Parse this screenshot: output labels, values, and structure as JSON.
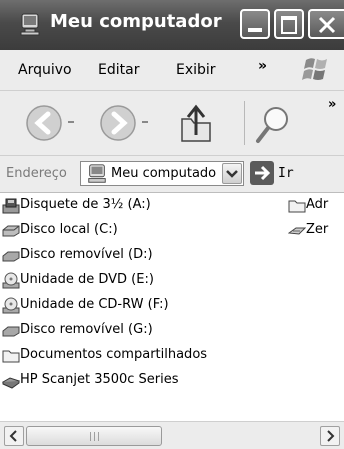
{
  "window": {
    "title": "Meu computador"
  },
  "menu": {
    "items": [
      "Arquivo",
      "Editar",
      "Exibir"
    ],
    "overflow": "»"
  },
  "toolbar": {
    "overflow": "»"
  },
  "address": {
    "label": "Endereço",
    "value": "Meu computador",
    "go_label": "Ir"
  },
  "items_left": [
    {
      "label": "Disquete de 3½ (A:)",
      "icon": "floppy-drive-icon"
    },
    {
      "label": "Disco local (C:)",
      "icon": "hard-disk-icon"
    },
    {
      "label": "Disco removível (D:)",
      "icon": "removable-disk-icon"
    },
    {
      "label": "Unidade de DVD (E:)",
      "icon": "dvd-drive-icon"
    },
    {
      "label": "Unidade de CD-RW (F:)",
      "icon": "cd-drive-icon"
    },
    {
      "label": "Disco removível (G:)",
      "icon": "removable-disk-icon"
    },
    {
      "label": "Documentos compartilhados",
      "icon": "folder-icon"
    },
    {
      "label": "HP Scanjet 3500c Series",
      "icon": "scanner-icon"
    }
  ],
  "items_right": [
    {
      "label": "Adr",
      "icon": "folder-icon"
    },
    {
      "label": "Zer",
      "icon": "compressed-folder-icon"
    }
  ]
}
